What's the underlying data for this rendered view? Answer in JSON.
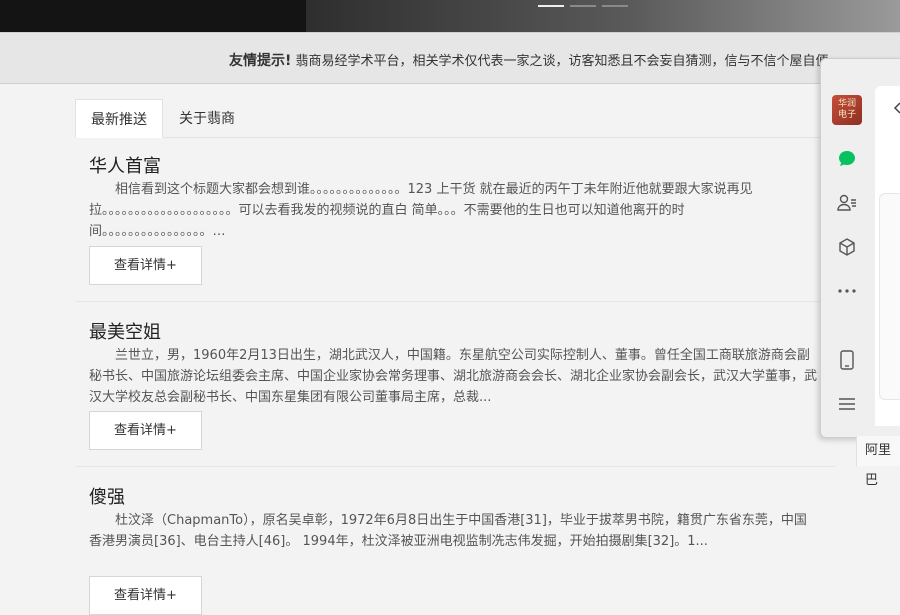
{
  "banner": {
    "slide_count": 3,
    "active_slide": 1
  },
  "notice": {
    "label": "友情提示!",
    "text": "翡商易经学术平台，相关学术仅代表一家之谈，访客知悉且不会妄自猜测，信与不信个屋自便"
  },
  "tabs": [
    {
      "label": "最新推送",
      "active": true
    },
    {
      "label": "关于翡商",
      "active": false
    }
  ],
  "articles": [
    {
      "title": "华人首富",
      "excerpt": "相信看到这个标题大家都会想到谁。。。。。。。。。。。。。。123  上干货  就在最近的丙午丁未年附近他就要跟大家说再见拉。。。。。。。。。。。。。。。。。。。。可以去看我发的视频说的直白 简单。。。不需要他的生日也可以知道他离开的时间。。。。。。。。。。。。。。。。…",
      "button": "查看详情+"
    },
    {
      "title": "最美空姐",
      "excerpt": "兰世立，男，1960年2月13日出生，湖北武汉人，中国籍。东星航空公司实际控制人、董事。曾任全国工商联旅游商会副秘书长、中国旅游论坛组委会主席、中国企业家协会常务理事、湖北旅游商会会长、湖北企业家协会副会长，武汉大学董事，武汉大学校友总会副秘书长、中国东星集团有限公司董事局主席，总裁...",
      "button": "查看详情+"
    },
    {
      "title": "傻强",
      "excerpt": "杜汶泽（ChapmanTo），原名吴卓彰，1972年6月8日出生于中国香港[31]，毕业于拔萃男书院，籍贯广东省东莞，中国香港男演员[36]、电台主持人[46]。       1994年，杜汶泽被亚洲电视监制冼志伟发掘，开始拍摄剧集[32]。1...",
      "button": "查看详情+"
    }
  ],
  "side_panel": {
    "logo_text": "华润电子",
    "icons": [
      "chat-icon",
      "contacts-icon",
      "cube-icon",
      "more-icon",
      "phone-icon",
      "menu-icon"
    ],
    "accent_color": "#07c160"
  },
  "partial_label": "阿里巴"
}
